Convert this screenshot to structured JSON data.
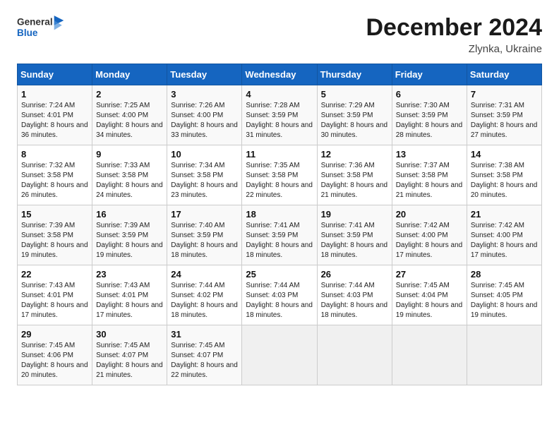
{
  "header": {
    "logo_general": "General",
    "logo_blue": "Blue",
    "month_title": "December 2024",
    "location": "Zlynka, Ukraine"
  },
  "weekdays": [
    "Sunday",
    "Monday",
    "Tuesday",
    "Wednesday",
    "Thursday",
    "Friday",
    "Saturday"
  ],
  "rows": [
    [
      {
        "day": "1",
        "sunrise": "Sunrise: 7:24 AM",
        "sunset": "Sunset: 4:01 PM",
        "daylight": "Daylight: 8 hours and 36 minutes."
      },
      {
        "day": "2",
        "sunrise": "Sunrise: 7:25 AM",
        "sunset": "Sunset: 4:00 PM",
        "daylight": "Daylight: 8 hours and 34 minutes."
      },
      {
        "day": "3",
        "sunrise": "Sunrise: 7:26 AM",
        "sunset": "Sunset: 4:00 PM",
        "daylight": "Daylight: 8 hours and 33 minutes."
      },
      {
        "day": "4",
        "sunrise": "Sunrise: 7:28 AM",
        "sunset": "Sunset: 3:59 PM",
        "daylight": "Daylight: 8 hours and 31 minutes."
      },
      {
        "day": "5",
        "sunrise": "Sunrise: 7:29 AM",
        "sunset": "Sunset: 3:59 PM",
        "daylight": "Daylight: 8 hours and 30 minutes."
      },
      {
        "day": "6",
        "sunrise": "Sunrise: 7:30 AM",
        "sunset": "Sunset: 3:59 PM",
        "daylight": "Daylight: 8 hours and 28 minutes."
      },
      {
        "day": "7",
        "sunrise": "Sunrise: 7:31 AM",
        "sunset": "Sunset: 3:59 PM",
        "daylight": "Daylight: 8 hours and 27 minutes."
      }
    ],
    [
      {
        "day": "8",
        "sunrise": "Sunrise: 7:32 AM",
        "sunset": "Sunset: 3:58 PM",
        "daylight": "Daylight: 8 hours and 26 minutes."
      },
      {
        "day": "9",
        "sunrise": "Sunrise: 7:33 AM",
        "sunset": "Sunset: 3:58 PM",
        "daylight": "Daylight: 8 hours and 24 minutes."
      },
      {
        "day": "10",
        "sunrise": "Sunrise: 7:34 AM",
        "sunset": "Sunset: 3:58 PM",
        "daylight": "Daylight: 8 hours and 23 minutes."
      },
      {
        "day": "11",
        "sunrise": "Sunrise: 7:35 AM",
        "sunset": "Sunset: 3:58 PM",
        "daylight": "Daylight: 8 hours and 22 minutes."
      },
      {
        "day": "12",
        "sunrise": "Sunrise: 7:36 AM",
        "sunset": "Sunset: 3:58 PM",
        "daylight": "Daylight: 8 hours and 21 minutes."
      },
      {
        "day": "13",
        "sunrise": "Sunrise: 7:37 AM",
        "sunset": "Sunset: 3:58 PM",
        "daylight": "Daylight: 8 hours and 21 minutes."
      },
      {
        "day": "14",
        "sunrise": "Sunrise: 7:38 AM",
        "sunset": "Sunset: 3:58 PM",
        "daylight": "Daylight: 8 hours and 20 minutes."
      }
    ],
    [
      {
        "day": "15",
        "sunrise": "Sunrise: 7:39 AM",
        "sunset": "Sunset: 3:58 PM",
        "daylight": "Daylight: 8 hours and 19 minutes."
      },
      {
        "day": "16",
        "sunrise": "Sunrise: 7:39 AM",
        "sunset": "Sunset: 3:59 PM",
        "daylight": "Daylight: 8 hours and 19 minutes."
      },
      {
        "day": "17",
        "sunrise": "Sunrise: 7:40 AM",
        "sunset": "Sunset: 3:59 PM",
        "daylight": "Daylight: 8 hours and 18 minutes."
      },
      {
        "day": "18",
        "sunrise": "Sunrise: 7:41 AM",
        "sunset": "Sunset: 3:59 PM",
        "daylight": "Daylight: 8 hours and 18 minutes."
      },
      {
        "day": "19",
        "sunrise": "Sunrise: 7:41 AM",
        "sunset": "Sunset: 3:59 PM",
        "daylight": "Daylight: 8 hours and 18 minutes."
      },
      {
        "day": "20",
        "sunrise": "Sunrise: 7:42 AM",
        "sunset": "Sunset: 4:00 PM",
        "daylight": "Daylight: 8 hours and 17 minutes."
      },
      {
        "day": "21",
        "sunrise": "Sunrise: 7:42 AM",
        "sunset": "Sunset: 4:00 PM",
        "daylight": "Daylight: 8 hours and 17 minutes."
      }
    ],
    [
      {
        "day": "22",
        "sunrise": "Sunrise: 7:43 AM",
        "sunset": "Sunset: 4:01 PM",
        "daylight": "Daylight: 8 hours and 17 minutes."
      },
      {
        "day": "23",
        "sunrise": "Sunrise: 7:43 AM",
        "sunset": "Sunset: 4:01 PM",
        "daylight": "Daylight: 8 hours and 17 minutes."
      },
      {
        "day": "24",
        "sunrise": "Sunrise: 7:44 AM",
        "sunset": "Sunset: 4:02 PM",
        "daylight": "Daylight: 8 hours and 18 minutes."
      },
      {
        "day": "25",
        "sunrise": "Sunrise: 7:44 AM",
        "sunset": "Sunset: 4:03 PM",
        "daylight": "Daylight: 8 hours and 18 minutes."
      },
      {
        "day": "26",
        "sunrise": "Sunrise: 7:44 AM",
        "sunset": "Sunset: 4:03 PM",
        "daylight": "Daylight: 8 hours and 18 minutes."
      },
      {
        "day": "27",
        "sunrise": "Sunrise: 7:45 AM",
        "sunset": "Sunset: 4:04 PM",
        "daylight": "Daylight: 8 hours and 19 minutes."
      },
      {
        "day": "28",
        "sunrise": "Sunrise: 7:45 AM",
        "sunset": "Sunset: 4:05 PM",
        "daylight": "Daylight: 8 hours and 19 minutes."
      }
    ],
    [
      {
        "day": "29",
        "sunrise": "Sunrise: 7:45 AM",
        "sunset": "Sunset: 4:06 PM",
        "daylight": "Daylight: 8 hours and 20 minutes."
      },
      {
        "day": "30",
        "sunrise": "Sunrise: 7:45 AM",
        "sunset": "Sunset: 4:07 PM",
        "daylight": "Daylight: 8 hours and 21 minutes."
      },
      {
        "day": "31",
        "sunrise": "Sunrise: 7:45 AM",
        "sunset": "Sunset: 4:07 PM",
        "daylight": "Daylight: 8 hours and 22 minutes."
      },
      null,
      null,
      null,
      null
    ]
  ]
}
